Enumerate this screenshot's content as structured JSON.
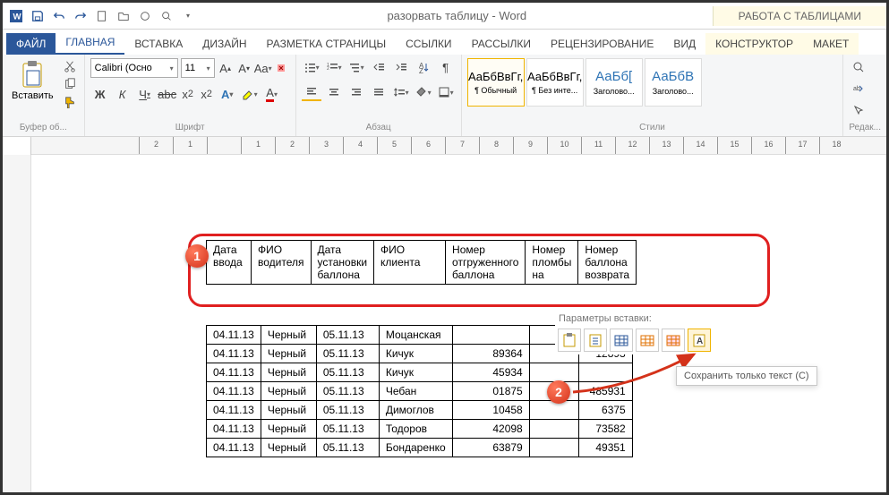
{
  "title": "разорвать таблицу - Word",
  "table_tools_label": "РАБОТА С ТАБЛИЦАМИ",
  "tabs": {
    "file": "ФАЙЛ",
    "home": "ГЛАВНАЯ",
    "insert": "ВСТАВКА",
    "design": "ДИЗАЙН",
    "layout": "РАЗМЕТКА СТРАНИЦЫ",
    "references": "ССЫЛКИ",
    "mailings": "РАССЫЛКИ",
    "review": "РЕЦЕНЗИРОВАНИЕ",
    "view": "ВИД",
    "constructor": "КОНСТРУКТОР",
    "table_layout": "МАКЕТ"
  },
  "ribbon": {
    "paste": "Вставить",
    "clipboard_label": "Буфер об...",
    "font_name": "Calibri (Осно",
    "font_size": "11",
    "font_label": "Шрифт",
    "paragraph_label": "Абзац",
    "styles_label": "Стили",
    "edit_label": "Редак...",
    "styles": [
      {
        "sample": "АаБбВвГг,",
        "name": "¶ Обычный"
      },
      {
        "sample": "АаБбВвГг,",
        "name": "¶ Без инте..."
      },
      {
        "sample": "АаБб[",
        "name": "Заголово..."
      },
      {
        "sample": "АаБбВ",
        "name": "Заголово..."
      }
    ]
  },
  "ruler": [
    "2",
    "1",
    "",
    "1",
    "2",
    "3",
    "4",
    "5",
    "6",
    "7",
    "8",
    "9",
    "10",
    "11",
    "12",
    "13",
    "14",
    "15",
    "16",
    "17",
    "18"
  ],
  "headers": [
    "Дата ввода",
    "ФИО водителя",
    "Дата установки баллона",
    "ФИО клиента",
    "Номер отгруженного баллона",
    "Номер пломбы на",
    "Номер баллона возврата"
  ],
  "rows": [
    [
      "04.11.13",
      "Черный",
      "05.11.13",
      "Моцанская",
      "",
      "",
      "2"
    ],
    [
      "04.11.13",
      "Черный",
      "05.11.13",
      "Кичук",
      "89364",
      "",
      "12893"
    ],
    [
      "04.11.13",
      "Черный",
      "05.11.13",
      "Кичук",
      "45934",
      "",
      ""
    ],
    [
      "04.11.13",
      "Черный",
      "05.11.13",
      "Чебан",
      "01875",
      "",
      "485931"
    ],
    [
      "04.11.13",
      "Черный",
      "05.11.13",
      "Димоглов",
      "10458",
      "",
      "6375"
    ],
    [
      "04.11.13",
      "Черный",
      "05.11.13",
      "Тодоров",
      "42098",
      "",
      "73582"
    ],
    [
      "04.11.13",
      "Черный",
      "05.11.13",
      "Бондаренко",
      "63879",
      "",
      "49351"
    ]
  ],
  "paste_options_label": "Параметры вставки:",
  "tooltip": "Сохранить только текст (С)",
  "callouts": {
    "one": "1",
    "two": "2"
  }
}
